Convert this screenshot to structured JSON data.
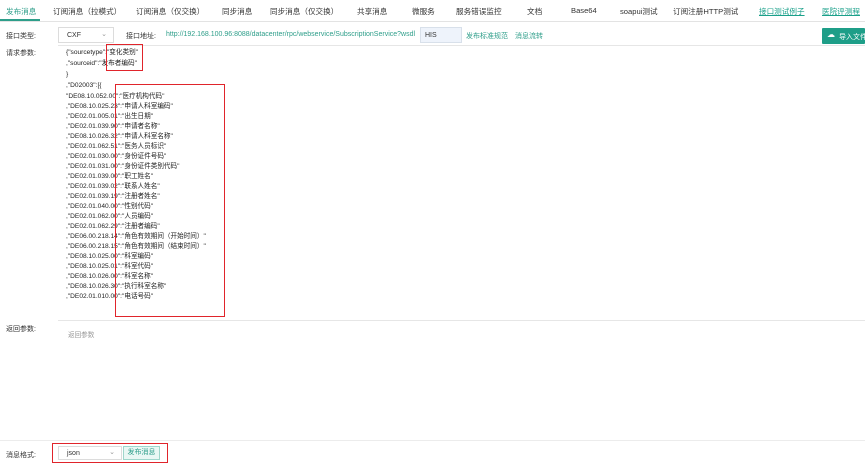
{
  "tabs": [
    {
      "label": "发布消息"
    },
    {
      "label": "订阅消息（拉模式）"
    },
    {
      "label": "订阅消息（仅交换）"
    },
    {
      "label": "同步消息"
    },
    {
      "label": "同步消息（仅交换）"
    },
    {
      "label": "共享消息"
    },
    {
      "label": "微服务"
    },
    {
      "label": "服务错误监控"
    },
    {
      "label": "文档"
    },
    {
      "label": "Base64"
    },
    {
      "label": "soapui测试"
    },
    {
      "label": "订阅注册HTTP测试"
    },
    {
      "label": "接口测试例子"
    },
    {
      "label": "医院评测程"
    }
  ],
  "active_tab": "发布消息",
  "interface": {
    "type_label": "接口类型:",
    "type_value": "CXF",
    "address_label": "接口地址:",
    "address_url": "http://192.168.100.96:8088/datacenter/rpc/webservice/SubscriptionService?wsdl",
    "his_value": "HIS",
    "spec_link": "发布标准规范",
    "flow_link": "消息流转",
    "import_label": "导入文件"
  },
  "request": {
    "label": "请求参数:",
    "lines": [
      "{\"sourcetype\":\"变化类别\"",
      ",\"sourceid\":\"发布者编码\"",
      "}",
      ",\"D02003\":[{",
      "\"DE08.10.052.00\":\"医疗机构代码\"",
      ",\"DE08.10.025.23\":\"申请人科室编码\"",
      ",\"DE02.01.005.01\":\"出生日期\"",
      ",\"DE02.01.039.90\":\"申请者名称\"",
      ",\"DE08.10.026.32\":\"申请人科室名称\"",
      ",\"DE02.01.062.51\":\"医务人员标识\"",
      ",\"DE02.01.030.00\":\"身份证件号码\"",
      ",\"DE02.01.031.00\":\"身份证件类别代码\"",
      ",\"DE02.01.039.00\":\"职工姓名\"",
      ",\"DE02.01.039.02\":\"联系人姓名\"",
      ",\"DE02.01.039.19\":\"注册者姓名\"",
      ",\"DE02.01.040.00\":\"性别代码\"",
      ",\"DE02.01.062.00\":\"人员编码\"",
      ",\"DE02.01.062.29\":\"注册者编码\"",
      ",\"DE06.00.218.14\":\"角色有效期间（开始时间）\"",
      ",\"DE06.00.218.15\":\"角色有效期间（结束时间）\"",
      ",\"DE08.10.025.00\":\"科室编码\"",
      ",\"DE08.10.025.01\":\"科室代码\"",
      ",\"DE08.10.026.00\":\"科室名称\"",
      ",\"DE08.10.026.30\":\"执行科室名称\"",
      ",\"DE02.01.010.00\":\"电话号码\""
    ]
  },
  "response": {
    "label": "返回参数:",
    "placeholder": "返回参数"
  },
  "bottom": {
    "format_label": "消息格式:",
    "format_value": "json",
    "publish_label": "发布消息"
  },
  "colors": {
    "accent": "#2e9e8a",
    "highlight": "#e0242b"
  }
}
